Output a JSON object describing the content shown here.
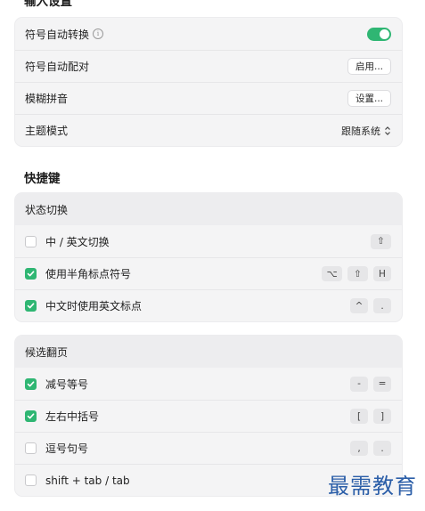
{
  "input_settings": {
    "title": "输入设置",
    "rows": {
      "auto_convert": {
        "label": "符号自动转换",
        "toggle_on": true
      },
      "auto_pair": {
        "label": "符号自动配对",
        "button": "启用..."
      },
      "fuzzy_pinyin": {
        "label": "模糊拼音",
        "button": "设置..."
      },
      "theme": {
        "label": "主题模式",
        "value": "跟随系统"
      }
    }
  },
  "shortcuts": {
    "title": "快捷键",
    "state_switch": {
      "header": "状态切换",
      "rows": [
        {
          "label": "中 / 英文切换",
          "checked": false,
          "keys": [
            "⇧"
          ]
        },
        {
          "label": "使用半角标点符号",
          "checked": true,
          "keys": [
            "⌥",
            "⇧",
            "H"
          ]
        },
        {
          "label": "中文时使用英文标点",
          "checked": true,
          "keys": [
            "^",
            "."
          ]
        }
      ]
    },
    "paging": {
      "header": "候选翻页",
      "rows": [
        {
          "label": "减号等号",
          "checked": true,
          "keys": [
            "-",
            "="
          ]
        },
        {
          "label": "左右中括号",
          "checked": true,
          "keys": [
            "[",
            "]"
          ]
        },
        {
          "label": "逗号句号",
          "checked": false,
          "keys": [
            ",",
            "."
          ]
        },
        {
          "label": "shift + tab / tab",
          "checked": false,
          "keys": []
        }
      ]
    }
  },
  "watermark": "最需教育",
  "colors": {
    "accent": "#2fb673",
    "watermark": "#2b5ea8"
  }
}
